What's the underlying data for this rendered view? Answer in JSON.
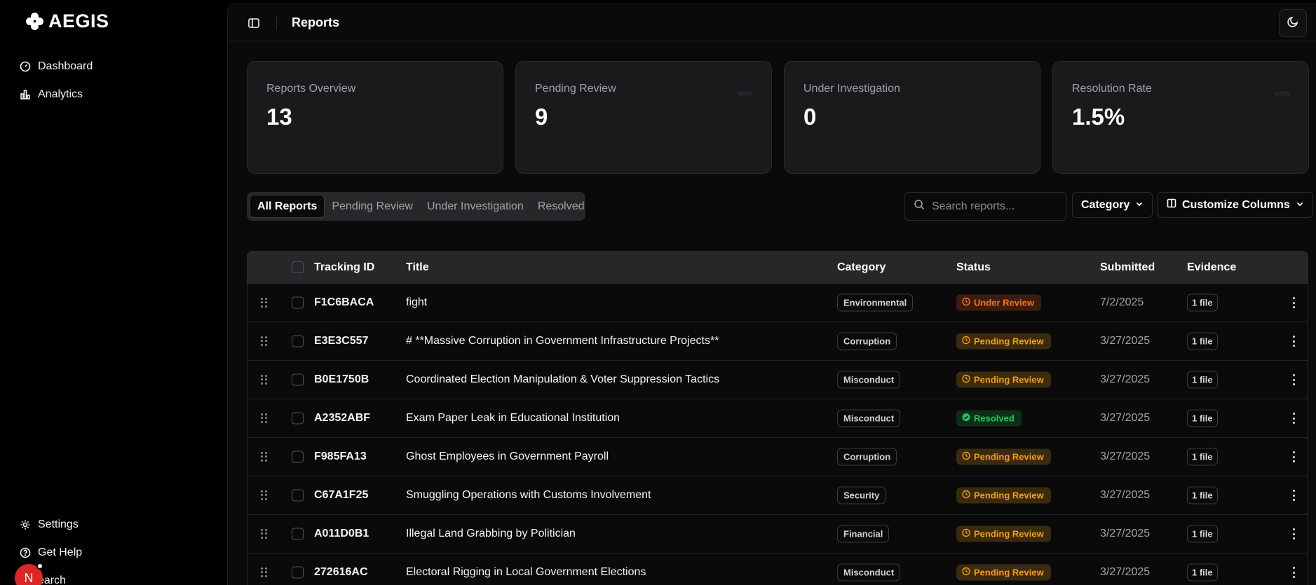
{
  "brand": {
    "name": "AEGIS"
  },
  "sidebar": {
    "nav": [
      {
        "label": "Dashboard",
        "icon": "gauge-icon"
      },
      {
        "label": "Analytics",
        "icon": "bar-chart-icon"
      }
    ],
    "footer": [
      {
        "label": "Settings",
        "icon": "gear-icon"
      },
      {
        "label": "Get Help",
        "icon": "help-circle-icon"
      },
      {
        "label": "earch",
        "icon": "search-icon"
      }
    ],
    "avatar_initial": "N"
  },
  "header": {
    "title": "Reports"
  },
  "stats": [
    {
      "label": "Reports Overview",
      "value": "13"
    },
    {
      "label": "Pending Review",
      "value": "9"
    },
    {
      "label": "Under Investigation",
      "value": "0"
    },
    {
      "label": "Resolution Rate",
      "value": "1.5%"
    }
  ],
  "tabs": [
    {
      "label": "All Reports",
      "active": true
    },
    {
      "label": "Pending Review",
      "active": false
    },
    {
      "label": "Under Investigation",
      "active": false
    },
    {
      "label": "Resolved",
      "active": false
    }
  ],
  "search": {
    "placeholder": "Search reports..."
  },
  "filters": {
    "category_label": "Category",
    "columns_label": "Customize Columns"
  },
  "table": {
    "columns": [
      "Tracking ID",
      "Title",
      "Category",
      "Status",
      "Submitted",
      "Evidence"
    ],
    "rows": [
      {
        "id": "F1C6BACA",
        "title": "fight",
        "category": "Environmental",
        "status": "Under Review",
        "status_kind": "review",
        "submitted": "7/2/2025",
        "evidence": "1 file"
      },
      {
        "id": "E3E3C557",
        "title": "# **Massive Corruption in Government Infrastructure Projects**",
        "category": "Corruption",
        "status": "Pending Review",
        "status_kind": "pending",
        "submitted": "3/27/2025",
        "evidence": "1 file"
      },
      {
        "id": "B0E1750B",
        "title": "Coordinated Election Manipulation & Voter Suppression Tactics",
        "category": "Misconduct",
        "status": "Pending Review",
        "status_kind": "pending",
        "submitted": "3/27/2025",
        "evidence": "1 file"
      },
      {
        "id": "A2352ABF",
        "title": "Exam Paper Leak in Educational Institution",
        "category": "Misconduct",
        "status": "Resolved",
        "status_kind": "resolved",
        "submitted": "3/27/2025",
        "evidence": "1 file"
      },
      {
        "id": "F985FA13",
        "title": "Ghost Employees in Government Payroll",
        "category": "Corruption",
        "status": "Pending Review",
        "status_kind": "pending",
        "submitted": "3/27/2025",
        "evidence": "1 file"
      },
      {
        "id": "C67A1F25",
        "title": "Smuggling Operations with Customs Involvement",
        "category": "Security",
        "status": "Pending Review",
        "status_kind": "pending",
        "submitted": "3/27/2025",
        "evidence": "1 file"
      },
      {
        "id": "A011D0B1",
        "title": "Illegal Land Grabbing by Politician",
        "category": "Financial",
        "status": "Pending Review",
        "status_kind": "pending",
        "submitted": "3/27/2025",
        "evidence": "1 file"
      },
      {
        "id": "272616AC",
        "title": "Electoral Rigging in Local Government Elections",
        "category": "Misconduct",
        "status": "Pending Review",
        "status_kind": "pending",
        "submitted": "3/27/2025",
        "evidence": "1 file"
      }
    ]
  },
  "colors": {
    "pending": "#f59e0b",
    "review": "#f97316",
    "resolved": "#22c55e",
    "avatar": "#dc2626"
  }
}
